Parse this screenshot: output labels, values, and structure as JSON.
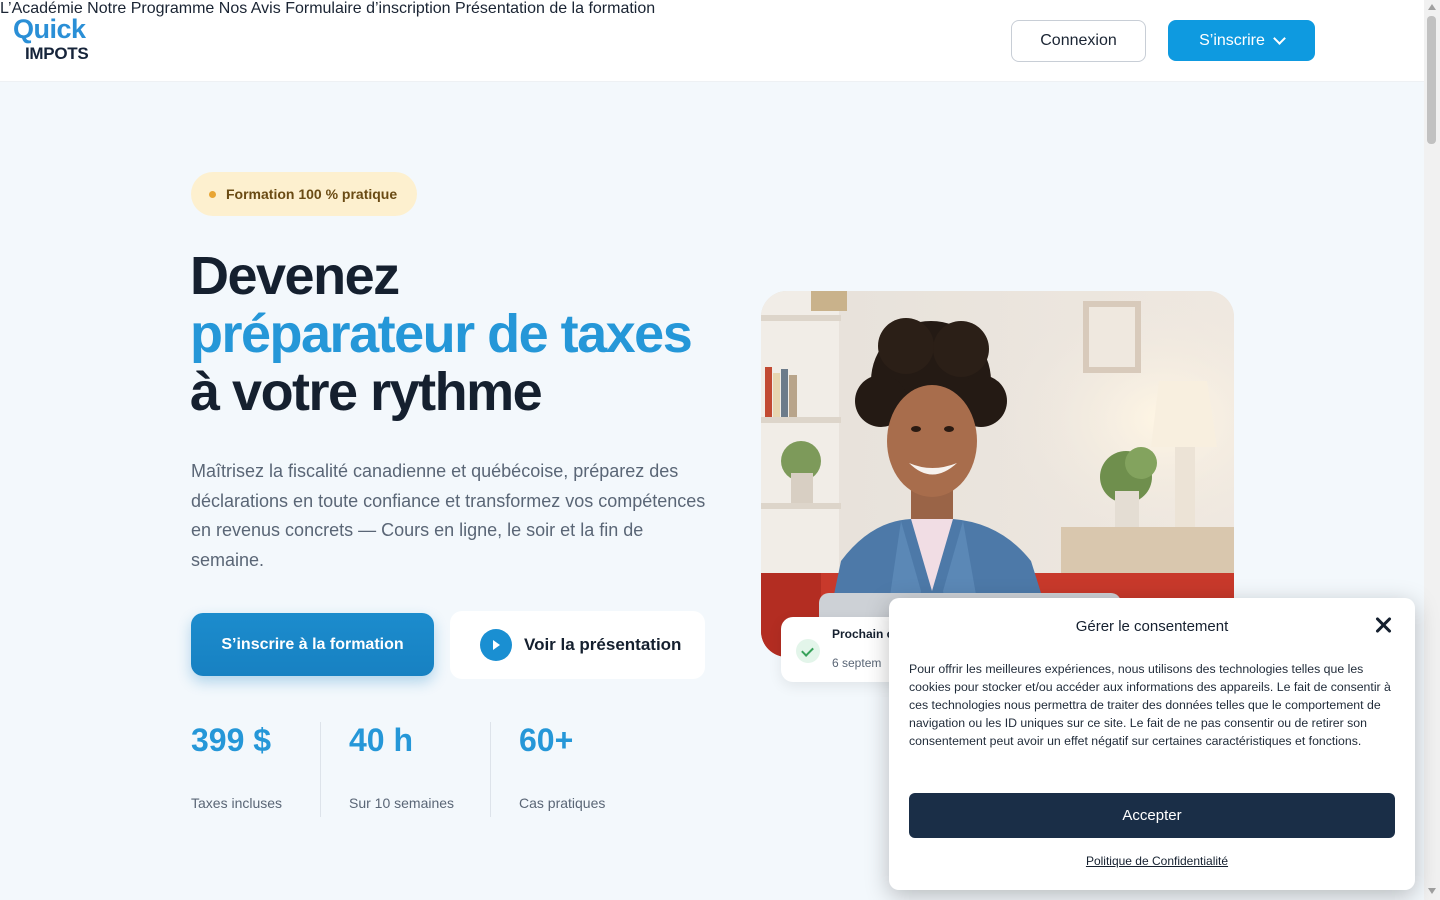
{
  "header": {
    "logo_top": "Quick",
    "logo_bottom": "IMPOTS",
    "nav": [
      "L’Académie",
      "Notre Programme",
      "Nos Avis",
      "Formulaire d’inscription",
      "Présentation de la formation"
    ],
    "login_label": "Connexion",
    "signup_label": "S’inscrire"
  },
  "hero": {
    "badge": "Formation 100 % pratique",
    "title_line1": "Devenez",
    "title_line2": "préparateur de taxes",
    "title_line3": "à votre rythme",
    "lead": "Maîtrisez la fiscalité canadienne et québécoise, préparez des déclarations en toute confiance et transformez vos compétences en revenus concrets — Cours en ligne, le soir et la fin de semaine.",
    "cta_primary": "S’inscrire à la formation",
    "cta_secondary": "Voir la présentation",
    "stats": [
      {
        "value": "399 $",
        "label": "Taxes incluses"
      },
      {
        "value": "40 h",
        "label": "Sur 10 semaines"
      },
      {
        "value": "60+",
        "label": "Cas pratiques"
      }
    ],
    "next_card_title": "Prochain c",
    "next_card_date": "6 septem"
  },
  "consent": {
    "title": "Gérer le consentement",
    "body": "Pour offrir les meilleures expériences, nous utilisons des technologies telles que les cookies pour stocker et/ou accéder aux informations des appareils. Le fait de consentir à ces technologies nous permettra de traiter des données telles que le comportement de navigation ou les ID uniques sur ce site. Le fait de ne pas consentir ou de retirer son consentement peut avoir un effet négatif sur certaines caractéristiques et fonctions.",
    "accept_label": "Accepter",
    "policy_label": "Politique de Confidentialité"
  },
  "colors": {
    "brand_blue": "#0e9ae0",
    "heading_blue": "#2597d8",
    "dark": "#15202f",
    "accept_bg": "#1a2e47"
  },
  "icons": [
    "play-circle-icon",
    "chevron-down-icon",
    "check-icon",
    "close-icon"
  ]
}
